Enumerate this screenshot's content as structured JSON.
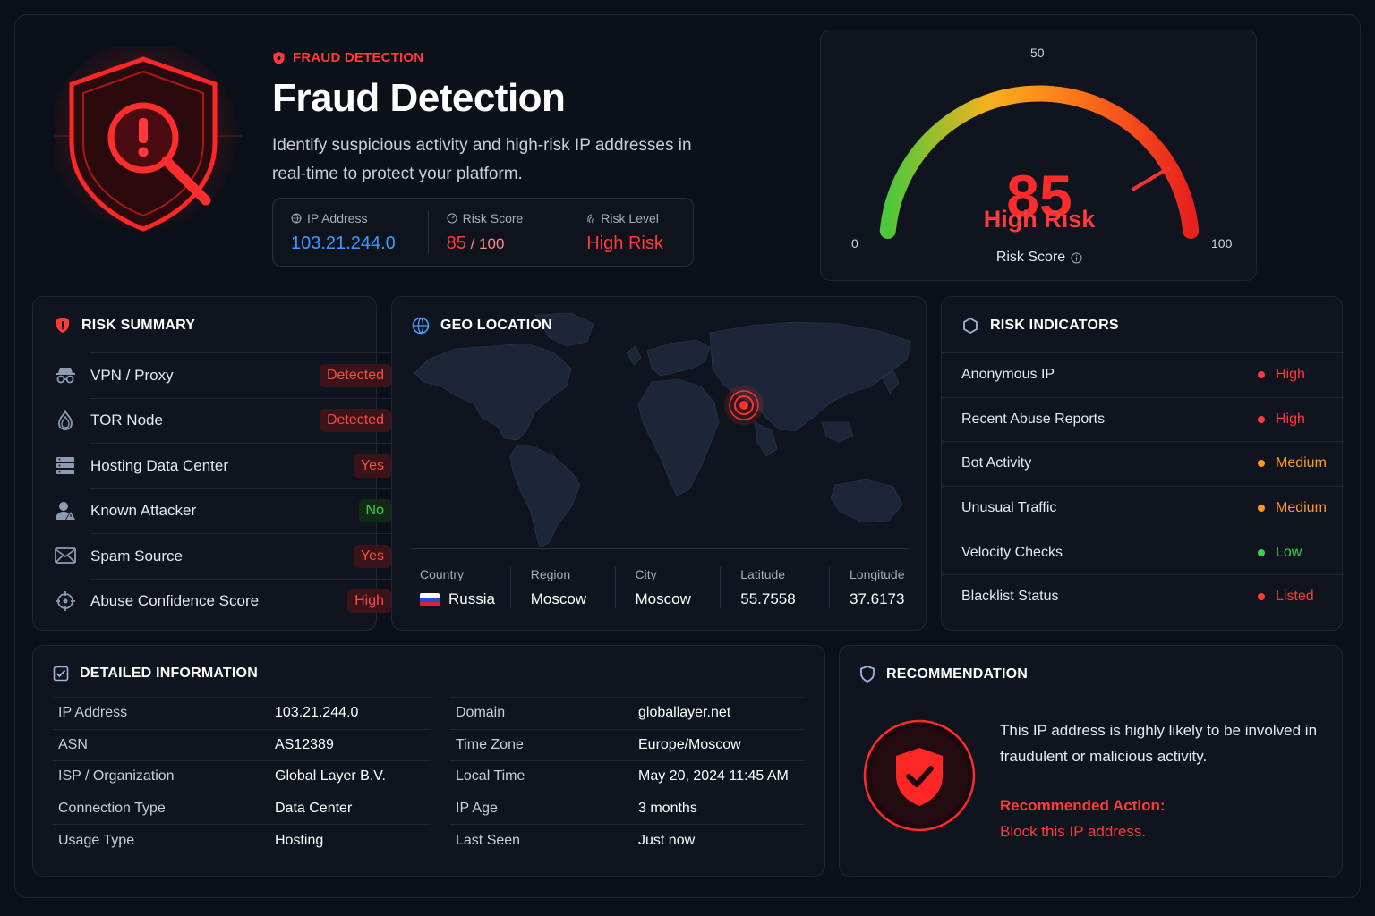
{
  "header": {
    "eyebrow": "FRAUD DETECTION",
    "title": "Fraud Detection",
    "description": "Identify suspicious activity and high-risk IP addresses in real-time to protect your platform.",
    "stats": [
      {
        "label": "IP Address",
        "value": "103.21.244.0"
      },
      {
        "label": "Risk Score",
        "value": "85",
        "suffix": " / 100"
      },
      {
        "label": "Risk Level",
        "value": "High Risk"
      }
    ]
  },
  "gauge": {
    "score": "85",
    "score_value": 85,
    "max": 100,
    "level": "High Risk",
    "label": "Risk Score",
    "tick_min": "0",
    "tick_mid": "50",
    "tick_max": "100",
    "colors": [
      "#4cc83a",
      "#f5b21e",
      "#ff7a1a",
      "#e8201e"
    ]
  },
  "risk_summary": {
    "title": "RISK SUMMARY",
    "items": [
      {
        "label": "VPN / Proxy",
        "value": "Detected",
        "status": "red",
        "icon": "incognito-icon"
      },
      {
        "label": "TOR Node",
        "value": "Detected",
        "status": "red",
        "icon": "onion-icon"
      },
      {
        "label": "Hosting Data Center",
        "value": "Yes",
        "status": "red",
        "icon": "server-icon"
      },
      {
        "label": "Known Attacker",
        "value": "No",
        "status": "green",
        "icon": "user-warning-icon"
      },
      {
        "label": "Spam Source",
        "value": "Yes",
        "status": "red",
        "icon": "envelope-icon"
      },
      {
        "label": "Abuse Confidence Score",
        "value": "High",
        "status": "red",
        "icon": "crosshair-icon"
      }
    ]
  },
  "geo": {
    "title": "GEO LOCATION",
    "fields": [
      {
        "label": "Country",
        "value": "Russia"
      },
      {
        "label": "Region",
        "value": "Moscow"
      },
      {
        "label": "City",
        "value": "Moscow"
      },
      {
        "label": "Latitude",
        "value": "55.7558"
      },
      {
        "label": "Longitude",
        "value": "37.6173"
      }
    ]
  },
  "risk_indicators": {
    "title": "RISK INDICATORS",
    "items": [
      {
        "label": "Anonymous IP",
        "value": "High",
        "color": "#ff3b3b"
      },
      {
        "label": "Recent Abuse Reports",
        "value": "High",
        "color": "#ff3b3b"
      },
      {
        "label": "Bot Activity",
        "value": "Medium",
        "color": "#ff9a1f"
      },
      {
        "label": "Unusual Traffic",
        "value": "Medium",
        "color": "#ff9a1f"
      },
      {
        "label": "Velocity Checks",
        "value": "Low",
        "color": "#3dd34a"
      },
      {
        "label": "Blacklist Status",
        "value": "Listed",
        "color": "#ff3b3b"
      }
    ]
  },
  "details": {
    "title": "DETAILED INFORMATION",
    "left": [
      {
        "key": "IP Address",
        "value": "103.21.244.0"
      },
      {
        "key": "ASN",
        "value": "AS12389"
      },
      {
        "key": "ISP / Organization",
        "value": "Global Layer B.V."
      },
      {
        "key": "Connection Type",
        "value": "Data Center"
      },
      {
        "key": "Usage Type",
        "value": "Hosting"
      }
    ],
    "right": [
      {
        "key": "Domain",
        "value": "globallayer.net"
      },
      {
        "key": "Time Zone",
        "value": "Europe/Moscow"
      },
      {
        "key": "Local Time",
        "value": "May 20, 2024 11:45 AM"
      },
      {
        "key": "IP Age",
        "value": "3 months"
      },
      {
        "key": "Last Seen",
        "value": "Just now"
      }
    ]
  },
  "recommendation": {
    "title": "RECOMMENDATION",
    "text": "This IP address is highly likely to be involved in fraudulent or malicious activity.",
    "action_label": "Recommended Action:",
    "action_value": "Block this IP address."
  }
}
